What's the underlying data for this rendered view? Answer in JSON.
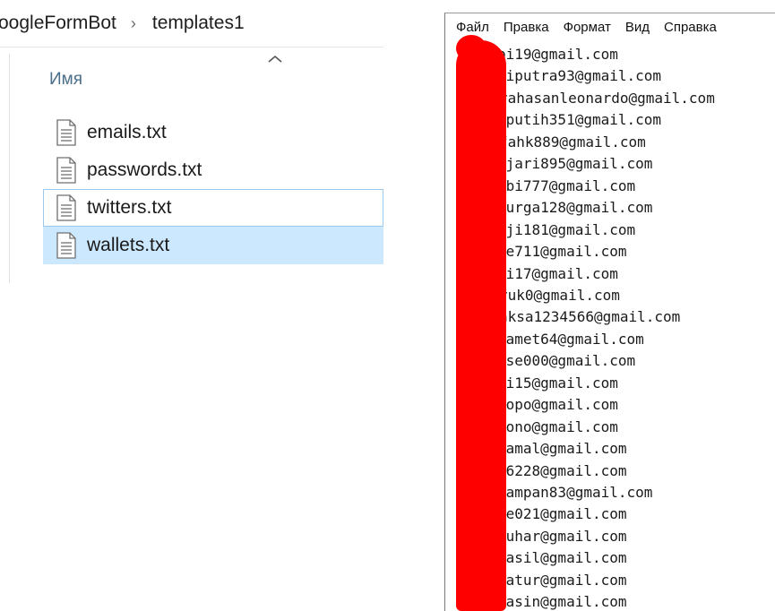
{
  "explorer": {
    "breadcrumb": [
      "oogleFormBot",
      "templates1"
    ],
    "column_header": "Имя",
    "files": [
      {
        "name": "emails.txt",
        "state": "normal"
      },
      {
        "name": "passwords.txt",
        "state": "normal"
      },
      {
        "name": "twitters.txt",
        "state": "hover"
      },
      {
        "name": "wallets.txt",
        "state": "selected"
      }
    ]
  },
  "notepad": {
    "menu": [
      "Файл",
      "Правка",
      "Формат",
      "Вид",
      "Справка"
    ],
    "redaction_color": "#ff0000",
    "lines": [
      "bi19@gmail.com",
      "diputra93@gmail.com",
      "yahasanleonardo@gmail.com",
      "kputih351@gmail.com",
      "fahk889@gmail.com",
      "gjari895@gmail.com",
      "obi777@gmail.com",
      "surga128@gmail.com",
      "uji181@gmail.com",
      "ge711@gmail.com",
      "bi17@gmail.com",
      "yuk0@gmail.com",
      "aksa1234566@gmail.com",
      "jamet64@gmail.com",
      "ase000@gmail.com",
      "bi15@gmail.com",
      "popo@gmail.com",
      "tono@gmail.com",
      "jamal@gmail.com",
      "16228@gmail.com",
      "tampan83@gmail.com",
      "we021@gmail.com",
      "suhar@gmail.com",
      "nasil@gmail.com",
      "hatur@gmail.com",
      "hasin@gmail.com"
    ]
  }
}
